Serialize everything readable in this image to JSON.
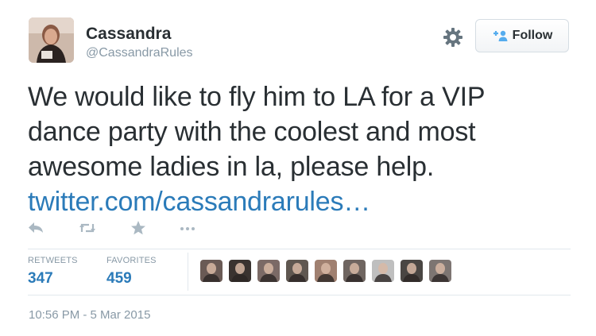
{
  "user": {
    "display_name": "Cassandra",
    "screen_name": "@CassandraRules"
  },
  "follow_button": {
    "label": "Follow"
  },
  "tweet": {
    "lines": [
      "We would like to fly him to LA for a VIP",
      "dance party with the coolest and most",
      "awesome ladies in la, please help."
    ],
    "link": "twitter.com/cassandrarules…"
  },
  "actions": [
    {
      "icon": "reply-icon"
    },
    {
      "icon": "retweet-icon"
    },
    {
      "icon": "favorite-star-icon"
    },
    {
      "icon": "more-options-icon"
    }
  ],
  "stats": {
    "retweets_label": "RETWEETS",
    "retweets_value": "347",
    "favorites_label": "FAVORITES",
    "favorites_value": "459"
  },
  "favoriters": [
    {
      "color": "#6a5a55"
    },
    {
      "color": "#3a3330"
    },
    {
      "color": "#7b6a66"
    },
    {
      "color": "#5f5750"
    },
    {
      "color": "#a08070"
    },
    {
      "color": "#6f6560"
    },
    {
      "color": "#bfbfbf"
    },
    {
      "color": "#4a4643"
    },
    {
      "color": "#7d7572"
    }
  ],
  "timestamp": "10:56 PM - 5 Mar 2015",
  "colors": {
    "link": "#2b7bb9",
    "text": "#292f33",
    "muted": "#8899a6",
    "border": "#e1e8ed"
  }
}
